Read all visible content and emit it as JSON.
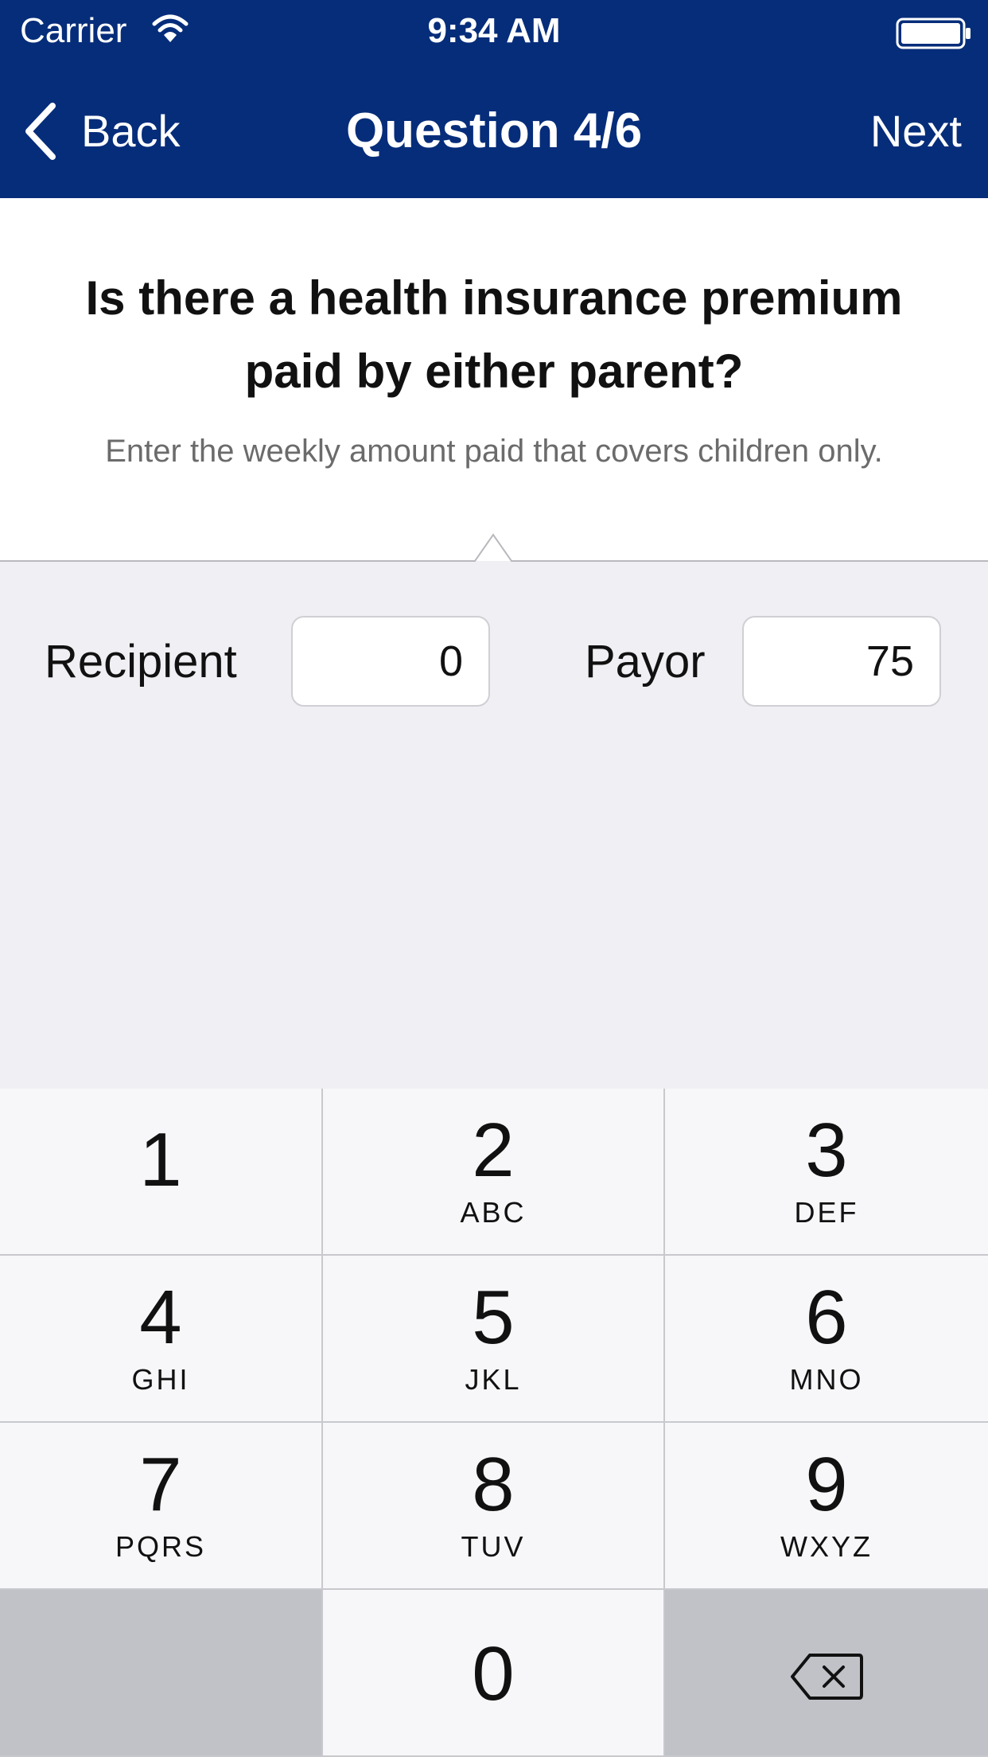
{
  "colors": {
    "nav_bg": "#062d7a",
    "nav_text": "#ffffff",
    "keypad_bg": "#f7f7f9",
    "keypad_dark": "#c0c2c8",
    "content_bg": "#efeff4"
  },
  "status_bar": {
    "carrier": "Carrier",
    "time": "9:34 AM",
    "icons": [
      "wifi-icon",
      "battery-icon"
    ]
  },
  "nav": {
    "back_label": "Back",
    "title": "Question 4/6",
    "next_label": "Next",
    "back_icon": "chevron-left-icon"
  },
  "question": {
    "title": "Is there a health insurance premium paid by either parent?",
    "subtitle": "Enter the weekly amount paid that covers children only."
  },
  "fields": {
    "recipient": {
      "label": "Recipient",
      "value": "0"
    },
    "payor": {
      "label": "Payor",
      "value": "75"
    }
  },
  "keypad": {
    "keys": [
      {
        "digit": "1",
        "letters": ""
      },
      {
        "digit": "2",
        "letters": "ABC"
      },
      {
        "digit": "3",
        "letters": "DEF"
      },
      {
        "digit": "4",
        "letters": "GHI"
      },
      {
        "digit": "5",
        "letters": "JKL"
      },
      {
        "digit": "6",
        "letters": "MNO"
      },
      {
        "digit": "7",
        "letters": "PQRS"
      },
      {
        "digit": "8",
        "letters": "TUV"
      },
      {
        "digit": "9",
        "letters": "WXYZ"
      },
      {
        "digit": "0",
        "letters": ""
      }
    ],
    "delete_icon": "delete-backspace-icon"
  }
}
